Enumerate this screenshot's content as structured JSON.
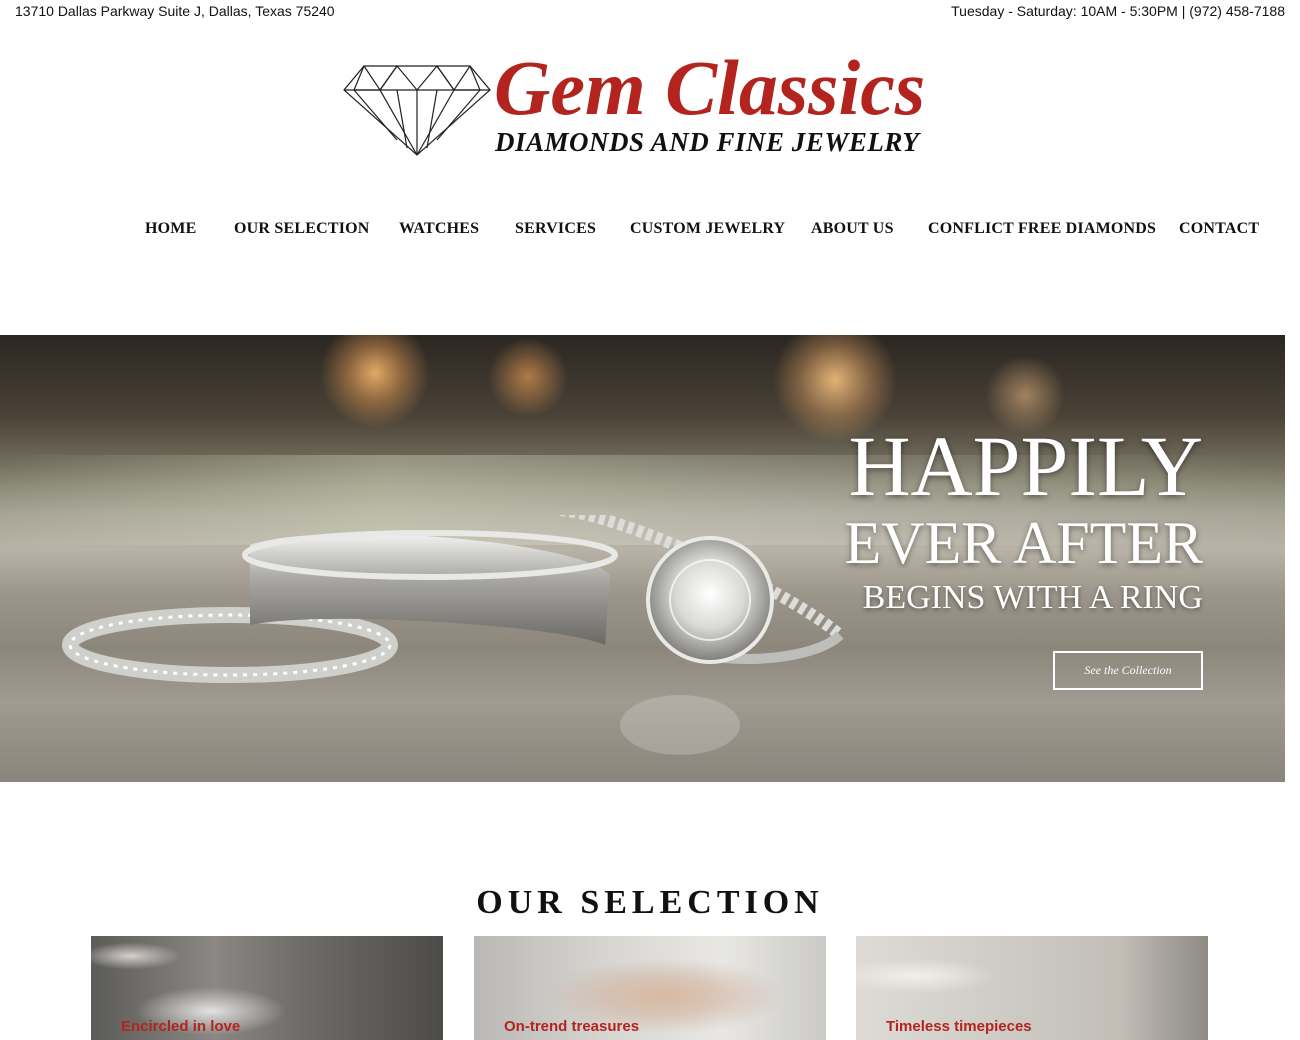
{
  "topbar": {
    "address": "13710 Dallas Parkway Suite J, Dallas, Texas 75240",
    "hours_phone": "Tuesday - Saturday: 10AM - 5:30PM | (972) 458-7188"
  },
  "logo": {
    "brand": "Gem Classics",
    "tagline": "DIAMONDS AND FINE JEWELRY",
    "icon": "diamond-icon",
    "brand_color": "#b3241f"
  },
  "nav": {
    "items": [
      {
        "label": "HOME"
      },
      {
        "label": "OUR SELECTION"
      },
      {
        "label": "WATCHES"
      },
      {
        "label": "SERVICES"
      },
      {
        "label": "CUSTOM JEWELRY"
      },
      {
        "label": "ABOUT US"
      },
      {
        "label": "CONFLICT FREE DIAMONDS"
      },
      {
        "label": "CONTACT"
      }
    ]
  },
  "hero": {
    "line1": "HAPPILY",
    "line2": "EVER AFTER",
    "line3": "BEGINS WITH A RING",
    "cta_label": "See the Collection"
  },
  "selection": {
    "title": "OUR SELECTION",
    "cards": [
      {
        "label": "Encircled in love"
      },
      {
        "label": "On-trend treasures"
      },
      {
        "label": "Timeless timepieces"
      }
    ]
  },
  "colors": {
    "accent": "#b3241f",
    "text": "#111111",
    "background": "#ffffff"
  }
}
